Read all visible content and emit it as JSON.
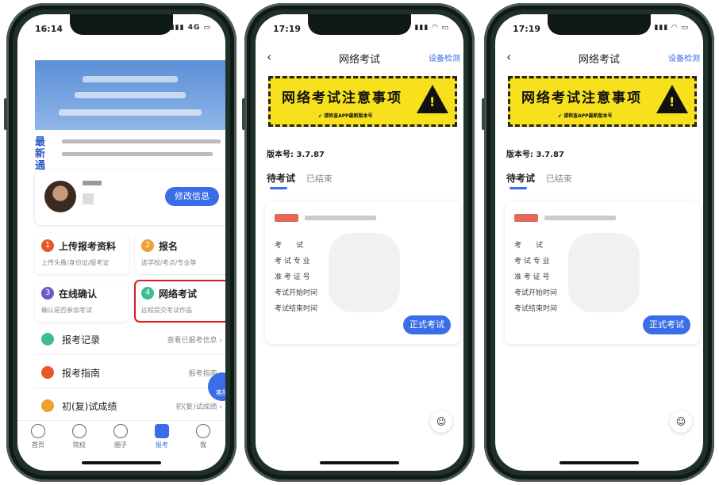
{
  "phone1": {
    "time": "16:14",
    "signal": "4G",
    "news_tag": "最新通告",
    "profile_button": "修改信息",
    "grid": [
      {
        "num": "1",
        "title": "上传报考资料",
        "sub": "上传头像/身份证/报考证",
        "color": "#e8572a"
      },
      {
        "num": "2",
        "title": "报名",
        "sub": "选学校/考点/专业等",
        "color": "#f0a030"
      },
      {
        "num": "3",
        "title": "在线确认",
        "sub": "确认是否参加考试",
        "color": "#6a5acd"
      },
      {
        "num": "4",
        "title": "网络考试",
        "sub": "远程提交考试作品",
        "color": "#3cbf8c"
      }
    ],
    "list": [
      {
        "title": "报考记录",
        "right": "查看已报考信息 ›",
        "color": "#3cbf8c"
      },
      {
        "title": "报考指南",
        "right": "报考指南 ›",
        "color": "#e8572a"
      },
      {
        "title": "初(复)试成绩",
        "right": "初(复)试成绩 ›",
        "color": "#f0a030"
      }
    ],
    "fab": "客服",
    "tabs": [
      "首页",
      "院校",
      "圈子",
      "报考",
      "我"
    ]
  },
  "exam": {
    "time": "17:19",
    "title": "网络考试",
    "device_check": "设备检测",
    "warning_title": "网络考试注意事项",
    "warning_sub": "↙ 请检查APP最新版本号",
    "version": "版本号: 3.7.87",
    "tab_pending": "待考试",
    "tab_done": "已结束",
    "rows": [
      "考　　试",
      "考 试 专 业",
      "准 考 证 号",
      "考试开始时间",
      "考试结束时间"
    ],
    "start_button": "正式考试"
  }
}
